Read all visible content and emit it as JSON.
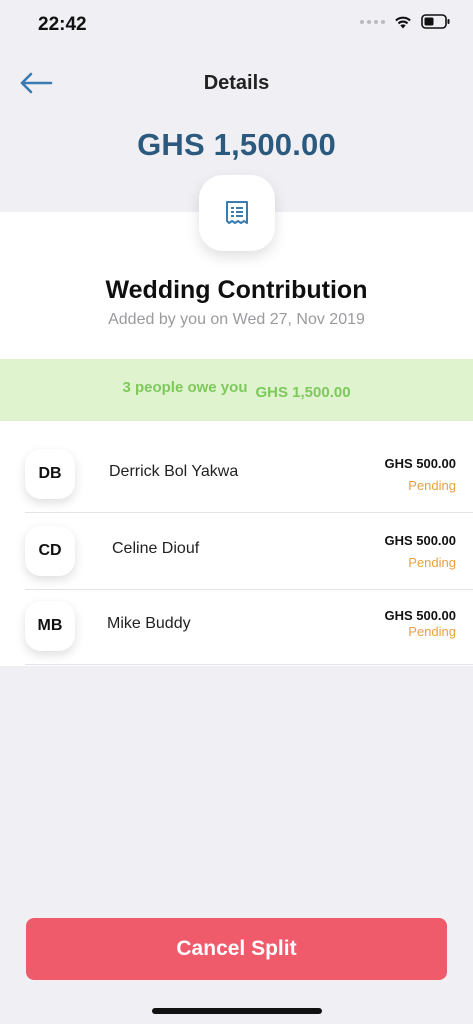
{
  "status_bar": {
    "time": "22:42",
    "icons": [
      "signal-dots-icon",
      "wifi-icon",
      "battery-icon"
    ]
  },
  "header": {
    "title": "Details",
    "back_icon": "back-arrow-icon"
  },
  "split": {
    "amount": "GHS 1,500.00",
    "icon": "receipt-icon",
    "title": "Wedding Contribution",
    "subtitle": "Added by you on Wed 27, Nov 2019"
  },
  "owe_banner": {
    "text": "3 people owe you",
    "amount": "GHS 1,500.00"
  },
  "people": [
    {
      "initials": "DB",
      "name": "Derrick Bol Yakwa",
      "amount": "GHS 500.00",
      "status": "Pending"
    },
    {
      "initials": "CD",
      "name": "Celine Diouf",
      "amount": "GHS 500.00",
      "status": "Pending"
    },
    {
      "initials": "MB",
      "name": "Mike Buddy",
      "amount": "GHS 500.00",
      "status": "Pending"
    }
  ],
  "actions": {
    "cancel_label": "Cancel Split"
  },
  "colors": {
    "accent_blue": "#2b5a7e",
    "back_arrow": "#3a7bb0",
    "owe_green": "#7ec95b",
    "owe_banner_bg": "#dff3cf",
    "pending_orange": "#e9a040",
    "cancel_red": "#ef5b6a"
  }
}
